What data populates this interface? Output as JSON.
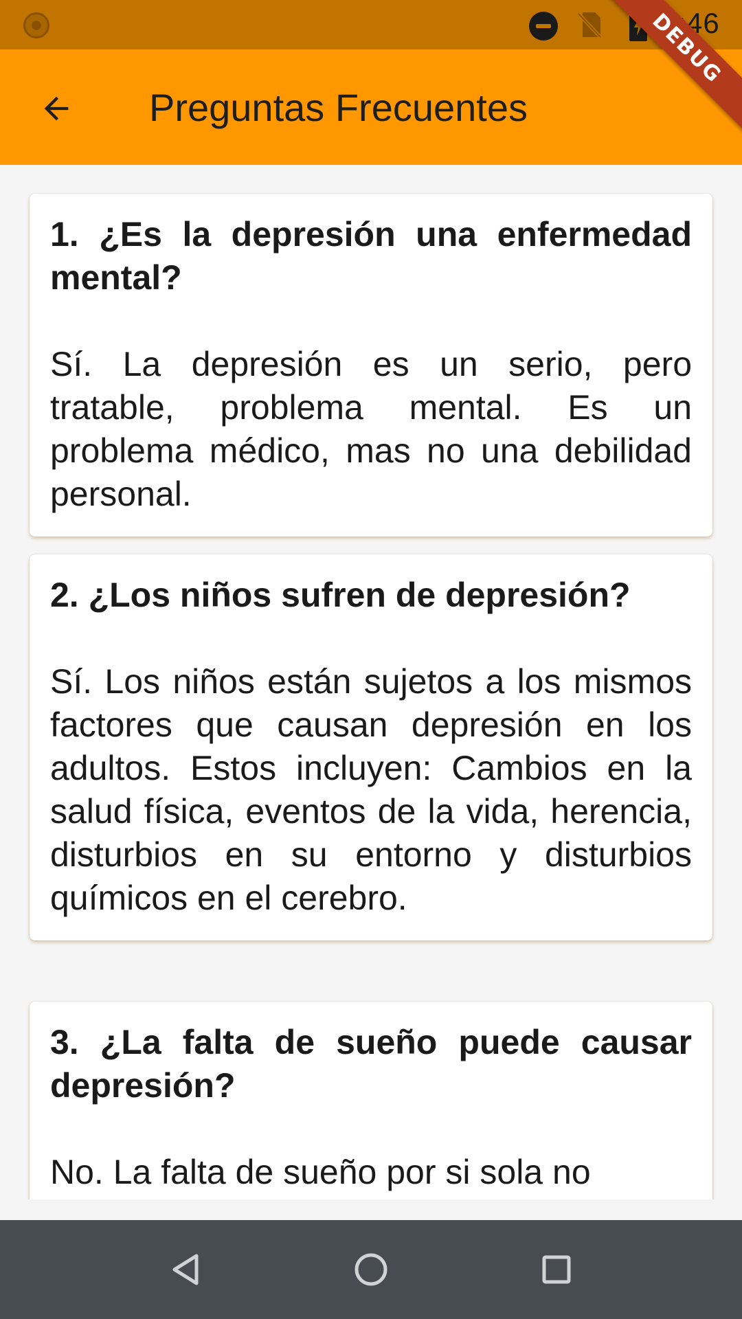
{
  "status_bar": {
    "time": "4:46",
    "icons": [
      "app-notification-icon",
      "do-not-disturb-icon",
      "no-sim-icon",
      "battery-charging-icon"
    ]
  },
  "app_bar": {
    "title": "Preguntas Frecuentes",
    "back_icon": "arrow-back-icon",
    "background": "#ff9800"
  },
  "debug_banner": "DEBUG",
  "faq": [
    {
      "question": "1. ¿Es la depresión una enfermedad mental?",
      "answer": "Sí. La depresión es un serio, pero tratable, problema mental. Es un problema médico, mas no una debilidad personal."
    },
    {
      "question": "2. ¿Los niños sufren de depresión?",
      "answer": "Sí. Los niños están sujetos a los mismos factores que causan depresión en los adultos. Estos incluyen: Cambios en la salud física, eventos de la vida, herencia, disturbios en su entorno y disturbios químicos en el cerebro."
    },
    {
      "question": "3. ¿La falta de sueño puede causar depresión?",
      "answer": "No. La falta de sueño por si sola no"
    }
  ],
  "nav_bar": {
    "buttons": [
      "back-triangle-icon",
      "home-circle-icon",
      "recents-square-icon"
    ]
  }
}
